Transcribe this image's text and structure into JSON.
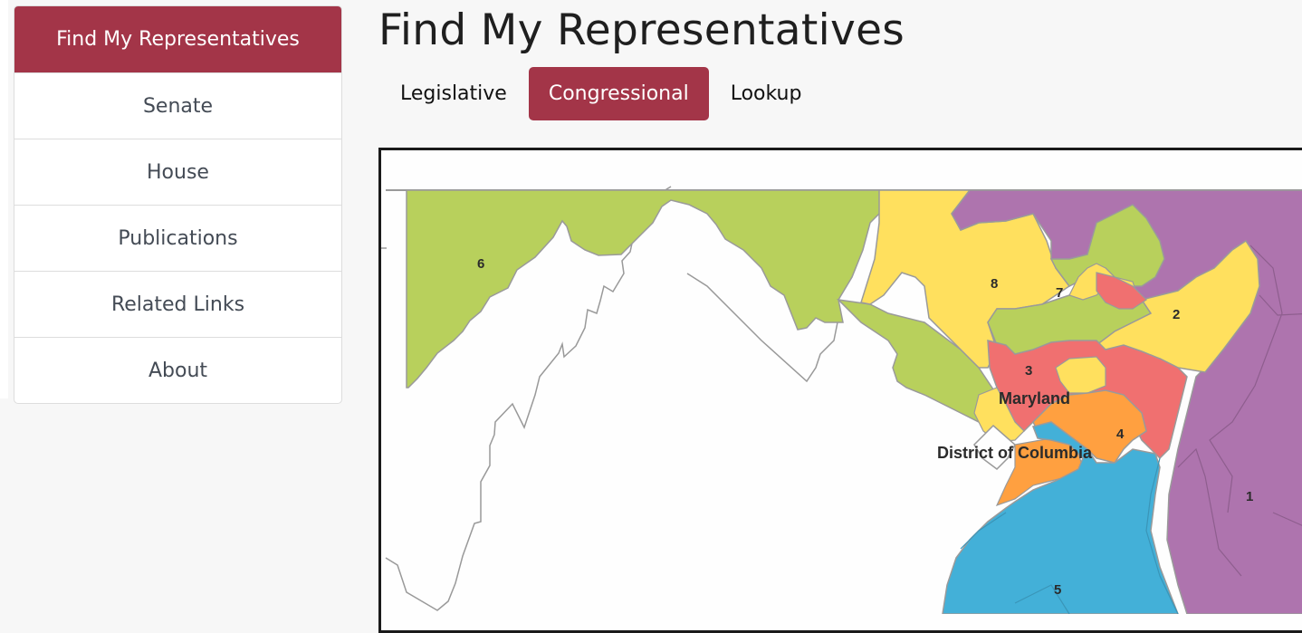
{
  "sidebar": {
    "items": [
      {
        "label": "Find My Representatives",
        "active": true
      },
      {
        "label": "Senate",
        "active": false
      },
      {
        "label": "House",
        "active": false
      },
      {
        "label": "Publications",
        "active": false
      },
      {
        "label": "Related Links",
        "active": false
      },
      {
        "label": "About",
        "active": false
      }
    ]
  },
  "header": {
    "title": "Find My Representatives"
  },
  "tabs": [
    {
      "label": "Legislative",
      "active": false
    },
    {
      "label": "Congressional",
      "active": true
    },
    {
      "label": "Lookup",
      "active": false
    }
  ],
  "map": {
    "labels": {
      "state": "Maryland",
      "dc": "District of Columbia"
    },
    "districts": [
      {
        "number": "1",
        "color": "#ae74ae"
      },
      {
        "number": "2",
        "color": "#ffe05e"
      },
      {
        "number": "3",
        "color": "#f07070"
      },
      {
        "number": "4",
        "color": "#ffa040"
      },
      {
        "number": "5",
        "color": "#43b0d8"
      },
      {
        "number": "6",
        "color": "#b8d05c"
      },
      {
        "number": "7",
        "color": "#b8d05c"
      },
      {
        "number": "8",
        "color": "#ffe05e"
      }
    ]
  },
  "colors": {
    "accent": "#a33548",
    "border": "#999999"
  }
}
